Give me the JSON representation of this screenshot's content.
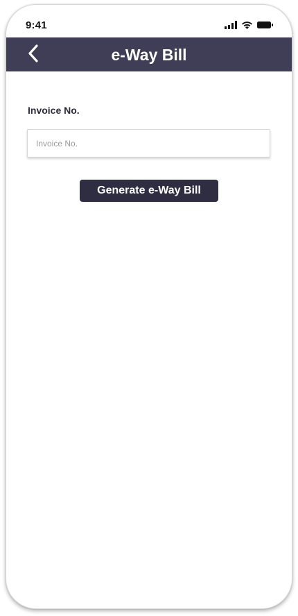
{
  "status_bar": {
    "time": "9:41",
    "icons": [
      "signal-icon",
      "wifi-icon",
      "battery-icon"
    ]
  },
  "header": {
    "back_icon": "chevron-left-icon",
    "title": "e-Way Bill",
    "background": "#403d56"
  },
  "form": {
    "invoice_label": "Invoice No.",
    "invoice_value": "",
    "invoice_placeholder": "Invoice No.",
    "submit_label": "Generate e-Way Bill",
    "submit_color": "#2f2d42"
  }
}
